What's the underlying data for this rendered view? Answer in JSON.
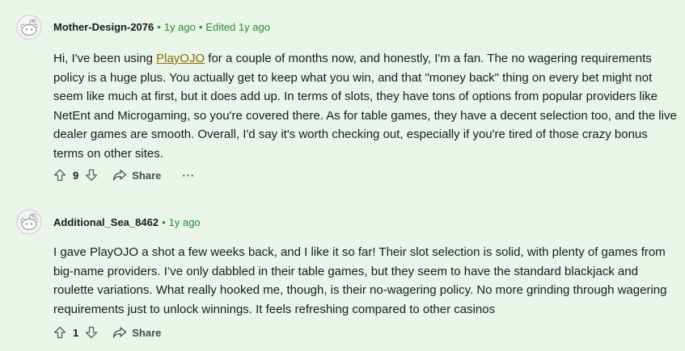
{
  "comments": [
    {
      "author": "Mother-Design-2076",
      "age": "1y ago",
      "edited": "Edited 1y ago",
      "text_before_link": "Hi, I've been using ",
      "link_text": "PlayOJO",
      "text_after_link": " for a couple of months now, and honestly, I'm a fan. The no wagering requirements policy is a huge plus. You actually get to keep what you win, and that \"money back\" thing on every bet might not seem like much at first, but it does add up. In terms of slots, they have tons of options from popular providers like NetEnt and Microgaming, so you're covered there. As for table games, they have a decent selection too, and the live dealer games are smooth. Overall, I'd say it's worth checking out, especially if you're tired of those crazy bonus terms on other sites.",
      "votes": "9",
      "share_label": "Share",
      "more_label": "···"
    },
    {
      "author": "Additional_Sea_8462",
      "age": "1y ago",
      "text": "I gave PlayOJO a shot a few weeks back, and I like it so far! Their slot selection is solid, with plenty of games from big-name providers. I’ve only dabbled in their table games, but they seem to have the standard blackjack and roulette variations. What really hooked me, though, is their no-wagering policy. No more grinding through wagering requirements just to unlock winnings. It feels refreshing compared to other casinos",
      "votes": "1",
      "share_label": "Share"
    }
  ],
  "icons": {
    "avatar": "snoo-avatar-icon",
    "upvote": "upvote-arrow-icon",
    "downvote": "downvote-arrow-icon",
    "share": "share-arrow-icon"
  },
  "colors": {
    "background": "#eaf5ea",
    "meta_green": "#2b8a2b",
    "link": "#8a6d00"
  }
}
